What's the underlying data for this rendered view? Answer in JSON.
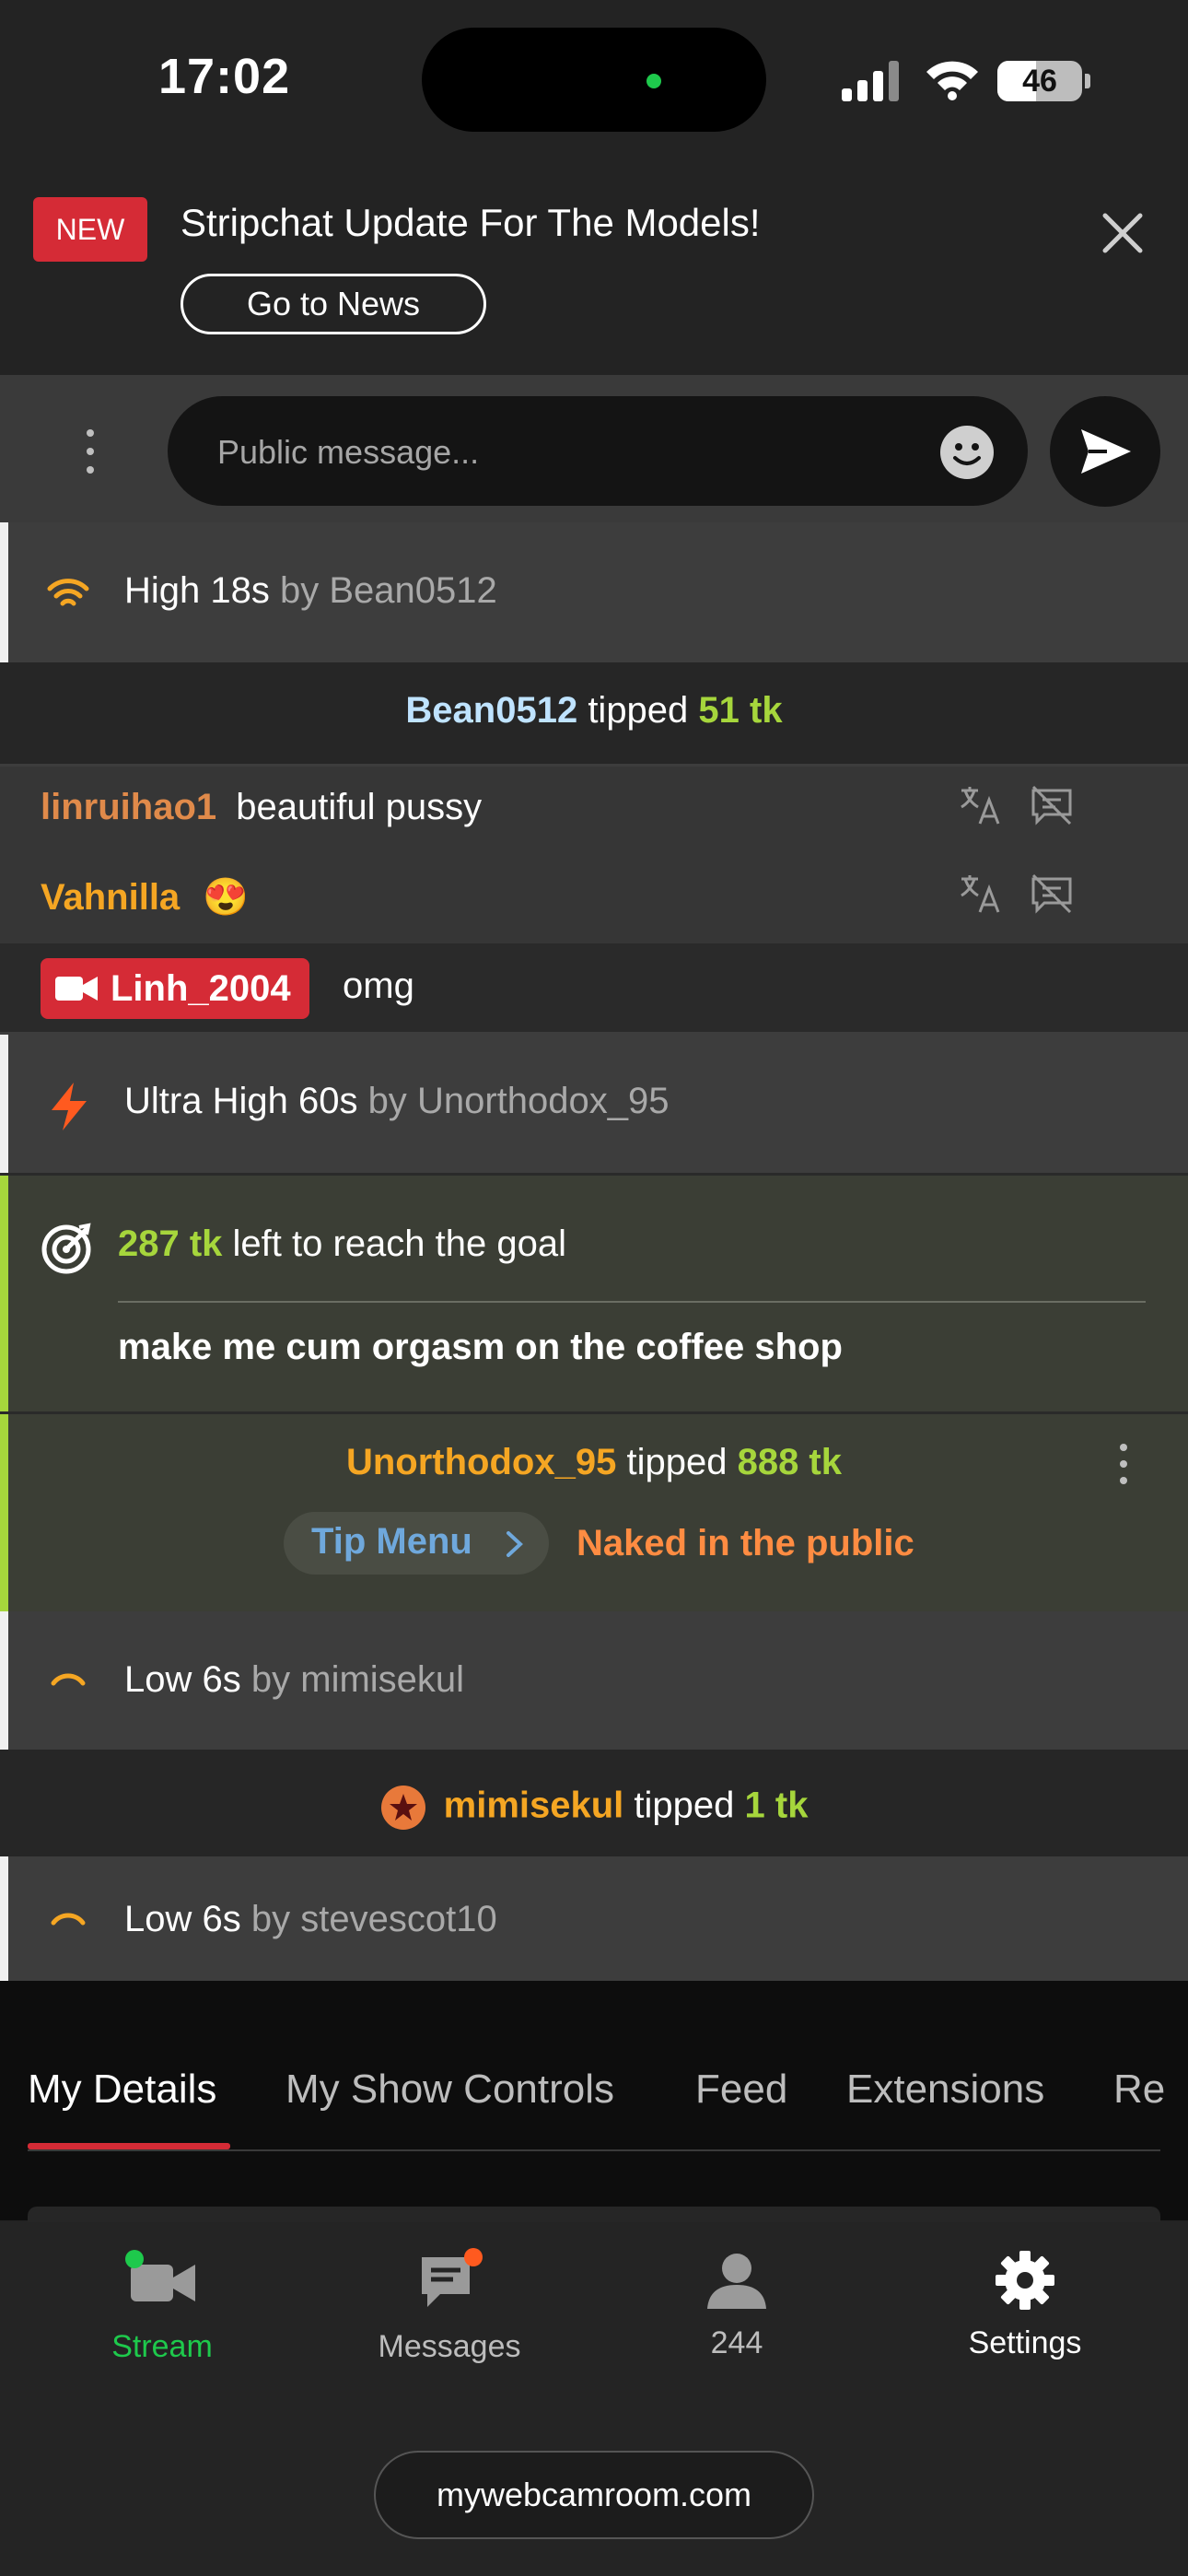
{
  "status_bar": {
    "time": "17:02",
    "battery": "46",
    "battery_level": 0.46
  },
  "news": {
    "badge": "NEW",
    "title": "Stripchat Update For The Models!",
    "button": "Go to News"
  },
  "composer": {
    "placeholder": "Public message..."
  },
  "chat": {
    "row1": {
      "level": "High 18s",
      "by": "by",
      "user": "Bean0512"
    },
    "row2": {
      "user": "Bean0512",
      "verb": "tipped",
      "amount": "51 tk"
    },
    "row3": {
      "user": "linruihao1",
      "text": "beautiful pussy"
    },
    "row4": {
      "user": "Vahnilla",
      "emoji": "😍"
    },
    "row5": {
      "user": "Linh_2004",
      "text": "omg"
    },
    "row6": {
      "level": "Ultra High 60s",
      "by": "by",
      "user": "Unorthodox_95"
    },
    "goal": {
      "amount": "287 tk",
      "text": "left to reach the goal",
      "subtitle": "make me cum orgasm on the coffee shop"
    },
    "tip": {
      "user": "Unorthodox_95",
      "verb": "tipped",
      "amount": "888 tk",
      "menu_label": "Tip Menu",
      "item": "Naked in the public"
    },
    "row9": {
      "level": "Low 6s",
      "by": "by",
      "user": "mimisekul"
    },
    "row10": {
      "user": "mimisekul",
      "verb": "tipped",
      "amount": "1 tk"
    },
    "row11": {
      "level": "Low 6s",
      "by": "by",
      "user": "stevescot10"
    }
  },
  "tabs": [
    "My Details",
    "My Show Controls",
    "Feed",
    "Extensions",
    "Re"
  ],
  "bottom_nav": {
    "stream": "Stream",
    "messages": "Messages",
    "viewers": "244",
    "settings": "Settings"
  },
  "domain": "mywebcamroom.com",
  "colors": {
    "accent_red": "#d52b36",
    "goal_green": "#a6d63c",
    "username_gold": "#f5a623",
    "stream_green": "#1ec94c"
  }
}
